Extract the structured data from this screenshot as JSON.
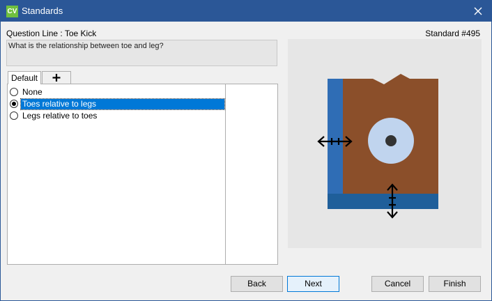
{
  "window": {
    "title": "Standards",
    "app_icon_text": "CV"
  },
  "header": {
    "question_line": "Question Line : Toe Kick",
    "standard_number": "Standard #495"
  },
  "question": {
    "text": "What is the relationship between toe and leg?"
  },
  "tabs": [
    {
      "label": "Default"
    }
  ],
  "options": [
    {
      "label": "None",
      "checked": false
    },
    {
      "label": "Toes relative to legs",
      "checked": true
    },
    {
      "label": "Legs relative to toes",
      "checked": false
    }
  ],
  "buttons": {
    "back": "Back",
    "next": "Next",
    "cancel": "Cancel",
    "finish": "Finish"
  },
  "colors": {
    "titlebar": "#2b5797",
    "selection": "#0078d7",
    "leg_blue": "#2f6db5",
    "cabinet_brown": "#8b4f2a",
    "toe_kick_blue": "#1f5f9a",
    "hole_light": "#c0d4ee",
    "hole_dark": "#333333"
  },
  "icons": {
    "close": "close-icon",
    "add_tab": "plus-icon",
    "horizontal_arrows": "horizontal-arrows-icon",
    "vertical_arrows": "vertical-arrows-icon"
  }
}
